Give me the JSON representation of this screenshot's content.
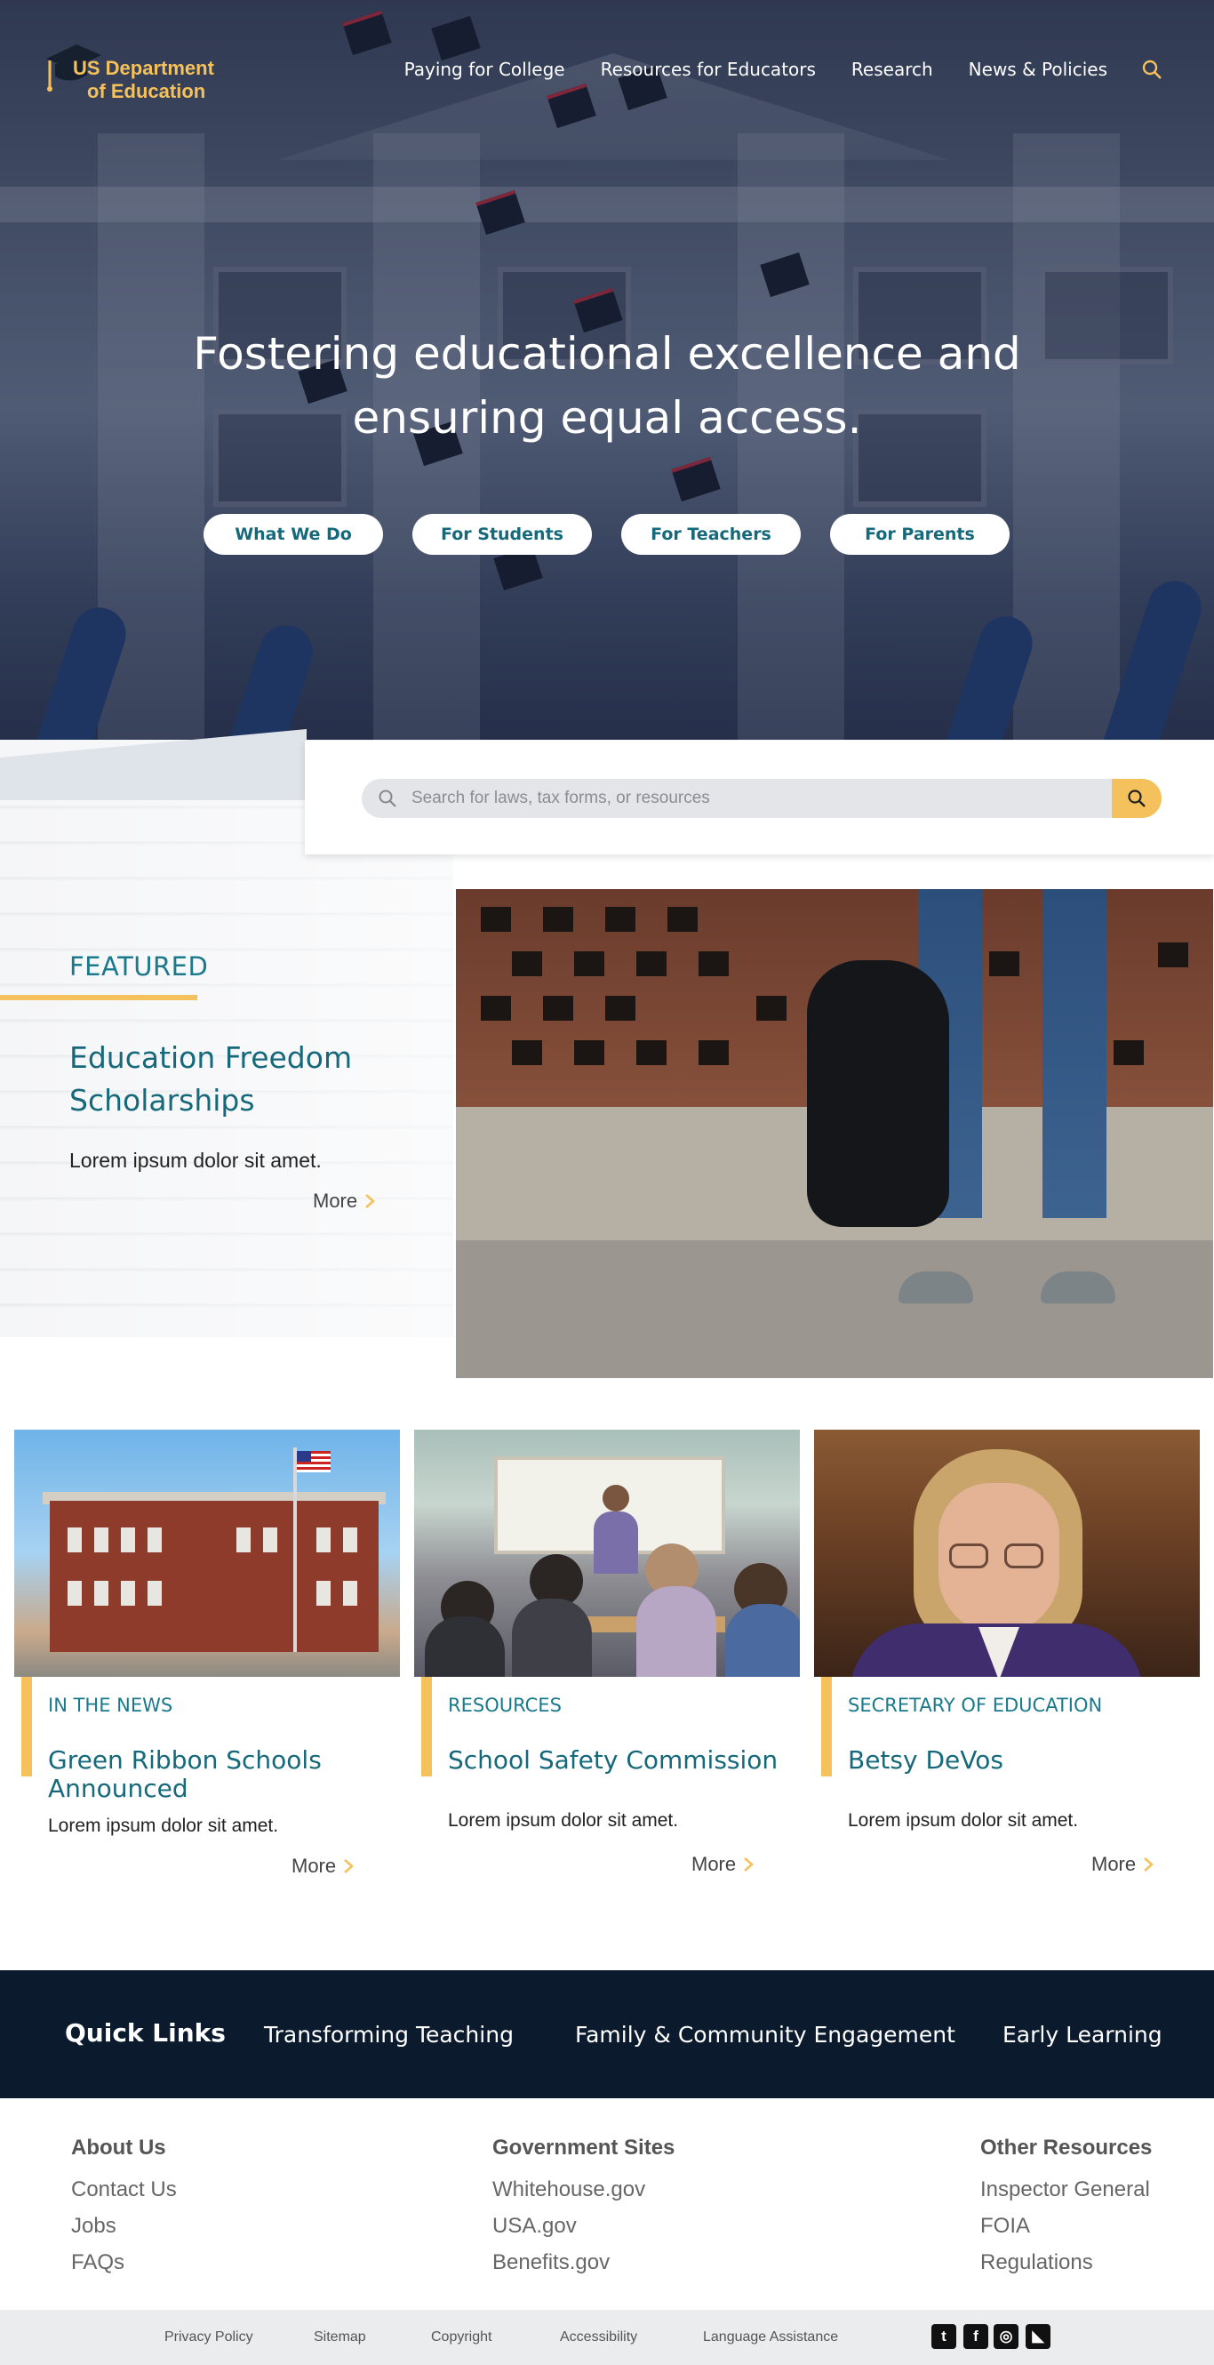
{
  "header": {
    "logo_line1": "US Department",
    "logo_line2": "of Education",
    "nav": [
      "Paying for College",
      "Resources for Educators",
      "Research",
      "News & Policies"
    ],
    "search_icon": "search-icon"
  },
  "hero": {
    "headline_line1": "Fostering educational excellence and",
    "headline_line2": "ensuring equal access.",
    "buttons": [
      "What We Do",
      "For Students",
      "For Teachers",
      "For Parents"
    ]
  },
  "search": {
    "placeholder": "Search for laws, tax forms, or resources",
    "value": ""
  },
  "featured": {
    "label": "FEATURED",
    "title": "Education Freedom Scholarships",
    "text": "Lorem ipsum dolor sit amet.",
    "more": "More"
  },
  "cards": [
    {
      "category": "IN THE NEWS",
      "title": "Green Ribbon Schools Announced",
      "text": "Lorem ipsum dolor sit amet.",
      "more": "More"
    },
    {
      "category": "RESOURCES",
      "title": "School Safety Commission",
      "text": "Lorem ipsum dolor sit amet.",
      "more": "More"
    },
    {
      "category": "SECRETARY OF EDUCATION",
      "title": "Betsy DeVos",
      "text": "Lorem ipsum dolor sit amet.",
      "more": "More"
    }
  ],
  "quick_links": {
    "title": "Quick Links",
    "links": [
      "Transforming Teaching",
      "Family & Community Engagement",
      "Early Learning"
    ]
  },
  "footer": {
    "columns": [
      {
        "heading": "About Us",
        "links": [
          "Contact Us",
          "Jobs",
          "FAQs"
        ]
      },
      {
        "heading": "Government Sites",
        "links": [
          "Whitehouse.gov",
          "USA.gov",
          "Benefits.gov"
        ]
      },
      {
        "heading": "Other Resources",
        "links": [
          "Inspector General",
          "FOIA",
          "Regulations"
        ]
      }
    ],
    "bottom_links": [
      "Privacy Policy",
      "Sitemap",
      "Copyright",
      "Accessibility",
      "Language Assistance"
    ],
    "social": [
      {
        "icon": "twitter-icon",
        "glyph": "t"
      },
      {
        "icon": "facebook-icon",
        "glyph": "f"
      },
      {
        "icon": "instagram-icon",
        "glyph": "◎"
      },
      {
        "icon": "rss-icon",
        "glyph": "◣"
      }
    ]
  },
  "colors": {
    "accent_gold": "#f5c15c",
    "teal": "#16697a",
    "navy": "#0b1a2c"
  }
}
